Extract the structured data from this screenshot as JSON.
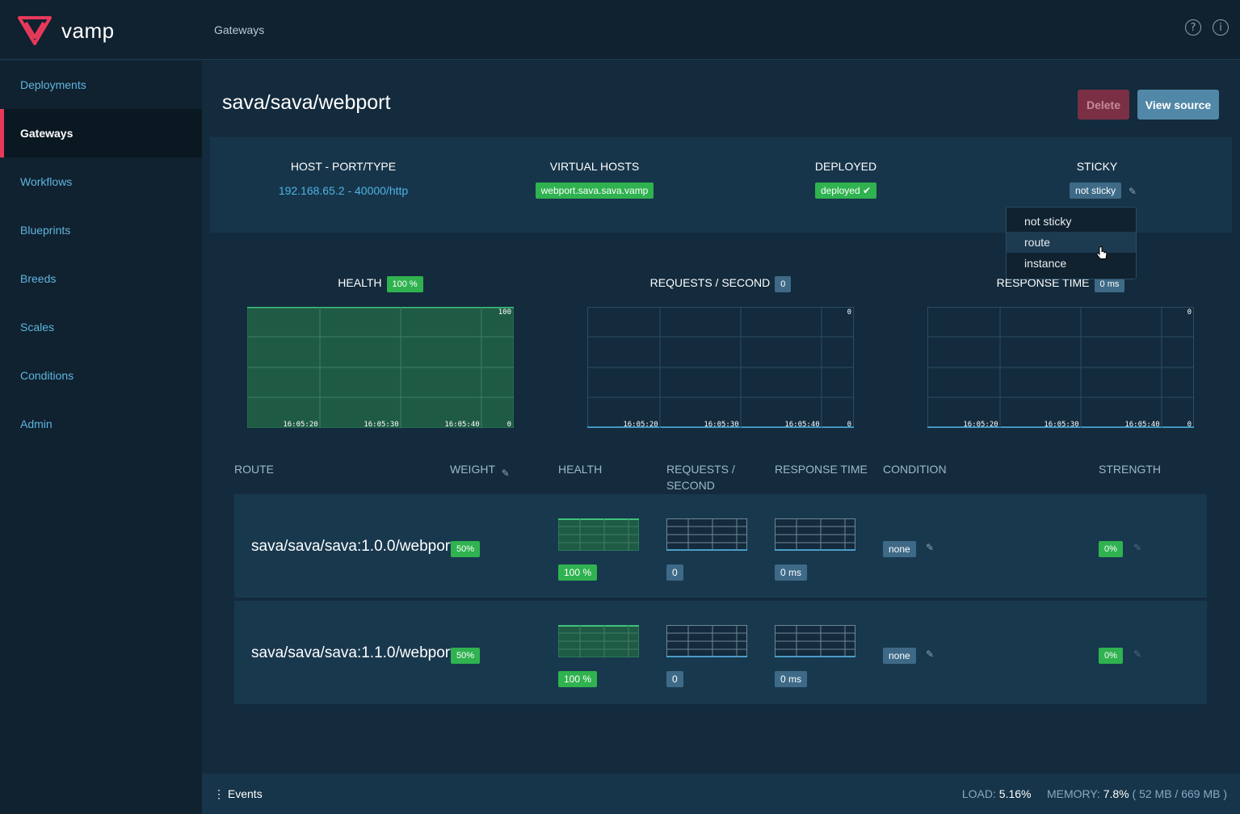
{
  "app": {
    "name": "vamp",
    "section": "Gateways",
    "colors": {
      "accent": "#e8395b",
      "green": "#2fb24f",
      "slate": "#3e6a87",
      "link": "#4cb3e6"
    }
  },
  "header": {
    "crumb": "Gateways",
    "icons": [
      "help-icon",
      "info-icon"
    ],
    "help_glyph": "?",
    "info_glyph": "i"
  },
  "sidebar": {
    "items": [
      {
        "label": "Deployments"
      },
      {
        "label": "Gateways"
      },
      {
        "label": "Workflows"
      },
      {
        "label": "Blueprints"
      },
      {
        "label": "Breeds"
      },
      {
        "label": "Scales"
      },
      {
        "label": "Conditions"
      },
      {
        "label": "Admin"
      }
    ]
  },
  "gateway": {
    "title": "sava/sava/webport",
    "delete_label": "Delete",
    "source_label": "View source",
    "host_head": "HOST - PORT/TYPE",
    "host_value": "192.168.65.2 - 40000/http",
    "vhosts_head": "VIRTUAL HOSTS",
    "vhost": "webport.sava.sava.vamp",
    "deployed_head": "DEPLOYED",
    "deployed": "deployed ✔",
    "sticky_head": "STICKY",
    "sticky": "not sticky",
    "sticky_options": [
      "not sticky",
      "route",
      "instance"
    ],
    "sticky_hover": "route"
  },
  "metrics": {
    "health_title": "HEALTH",
    "health_badge": "100 %",
    "rps_title": "REQUESTS / SECOND",
    "rps_badge": "0",
    "rt_title": "RESPONSE TIME",
    "rt_badge": "0 ms",
    "health_max": "100",
    "rps_max": "0",
    "rt_max": "0",
    "min": "0",
    "x_ticks": [
      "16:05:20",
      "16:05:30",
      "16:05:40"
    ]
  },
  "table": {
    "headers": {
      "route": "ROUTE",
      "weight": "WEIGHT",
      "health": "HEALTH",
      "requests_1": "REQUESTS /",
      "requests_2": "SECOND",
      "response": "RESPONSE TIME",
      "condition": "CONDITION",
      "strength": "STRENGTH"
    },
    "rows": [
      {
        "route": "sava/sava/sava:1.0.0/webport",
        "weight": "50%",
        "health": "100 %",
        "rps": "0",
        "rt": "0 ms",
        "condition": "none",
        "strength": "0%"
      },
      {
        "route": "sava/sava/sava:1.1.0/webport",
        "weight": "50%",
        "health": "100 %",
        "rps": "0",
        "rt": "0 ms",
        "condition": "none",
        "strength": "0%"
      }
    ]
  },
  "footer": {
    "events": "Events",
    "load_label": "LOAD:",
    "load": "5.16%",
    "memory_label": "MEMORY:",
    "memory": "7.8%",
    "memory_detail": "( 52 MB / 669 MB )"
  }
}
